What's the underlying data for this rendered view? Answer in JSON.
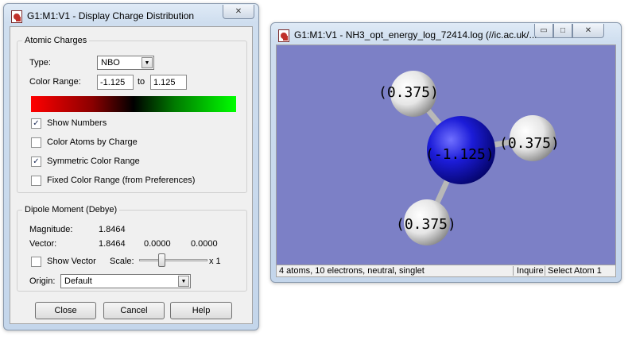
{
  "dialog": {
    "title": "G1:M1:V1 - Display Charge Distribution",
    "close_glyph": "✕",
    "atomic_charges": {
      "group_label": "Atomic Charges",
      "type_label": "Type:",
      "type_value": "NBO",
      "color_range_label": "Color Range:",
      "range_min": "-1.125",
      "range_to": "to",
      "range_max": "1.125",
      "gradient_colors": [
        "#ff0000",
        "#000000",
        "#00ff00"
      ],
      "options": [
        {
          "label": "Show Numbers",
          "checked": true
        },
        {
          "label": "Color Atoms by Charge",
          "checked": false
        },
        {
          "label": "Symmetric Color Range",
          "checked": true
        },
        {
          "label": "Fixed Color Range (from Preferences)",
          "checked": false
        }
      ]
    },
    "dipole": {
      "group_label": "Dipole Moment (Debye)",
      "magnitude_label": "Magnitude:",
      "magnitude_value": "1.8464",
      "vector_label": "Vector:",
      "vector_x": "1.8464",
      "vector_y": "0.0000",
      "vector_z": "0.0000",
      "show_vector_label": "Show Vector",
      "show_vector_checked": false,
      "scale_label": "Scale:",
      "scale_value_label": "x 1",
      "origin_label": "Origin:",
      "origin_value": "Default"
    },
    "buttons": {
      "close": "Close",
      "cancel": "Cancel",
      "help": "Help"
    }
  },
  "viewer": {
    "title": "G1:M1:V1 - NH3_opt_energy_log_72414.log (//ic.ac.uk/...",
    "minimize_glyph": "▭",
    "maximize_glyph": "□",
    "close_glyph": "✕",
    "background_color": "#7c80c6",
    "atoms": [
      {
        "element": "N",
        "charge_label": "(-1.125)",
        "color": "#1c1cd8"
      },
      {
        "element": "H",
        "charge_label": "(0.375)",
        "color": "#ffffff"
      },
      {
        "element": "H",
        "charge_label": "(0.375)",
        "color": "#ffffff"
      },
      {
        "element": "H",
        "charge_label": "(0.375)",
        "color": "#ffffff"
      }
    ],
    "status": {
      "info": "4 atoms, 10 electrons, neutral, singlet",
      "mode": "Inquire",
      "action": "Select Atom 1"
    }
  }
}
